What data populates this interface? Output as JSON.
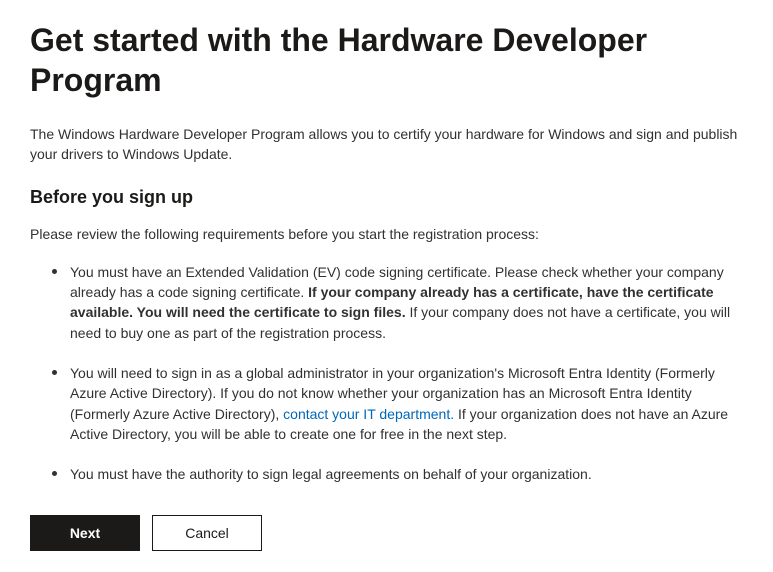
{
  "header": {
    "title": "Get started with the Hardware Developer Program"
  },
  "intro": "The Windows Hardware Developer Program allows you to certify your hardware for Windows and sign and publish your drivers to Windows Update.",
  "section": {
    "heading": "Before you sign up",
    "review_text": "Please review the following requirements before you start the registration process:"
  },
  "requirements": {
    "item1": {
      "part1": "You must have an Extended Validation (EV) code signing certificate. Please check whether your company already has a code signing certificate. ",
      "bold": "If your company already has a certificate, have the certificate available. You will need the certificate to sign files.",
      "part2": " If your company does not have a certificate, you will need to buy one as part of the registration process."
    },
    "item2": {
      "part1": "You will need to sign in as a global administrator in your organization's Microsoft Entra Identity (Formerly Azure Active Directory). If you do not know whether your organization has an Microsoft Entra Identity (Formerly Azure Active Directory), ",
      "link_text": "contact your IT department.",
      "part2": " If your organization does not have an Azure Active Directory, you will be able to create one for free in the next step."
    },
    "item3": {
      "text": "You must have the authority to sign legal agreements on behalf of your organization."
    }
  },
  "buttons": {
    "next_label": "Next",
    "cancel_label": "Cancel"
  }
}
